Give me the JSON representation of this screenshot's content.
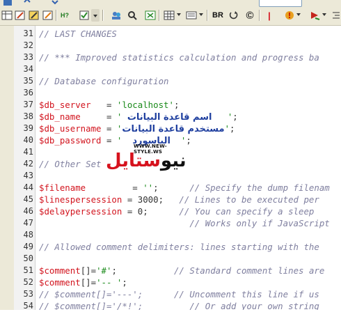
{
  "toolbar": {
    "buttons_row2": [
      {
        "icon": "table-icon"
      },
      {
        "icon": "edit-icon"
      },
      {
        "icon": "pencil-icon"
      },
      {
        "icon": "help-icon"
      },
      {
        "icon": "checklist-icon"
      },
      {
        "icon": "dropdown-arrow-icon"
      },
      {
        "icon": "users-icon"
      },
      {
        "icon": "find-icon"
      },
      {
        "icon": "format-icon"
      },
      {
        "icon": "table-grid-icon"
      },
      {
        "icon": "list-icon"
      },
      {
        "icon": "rotate-icon"
      },
      {
        "icon": "copyright-icon"
      },
      {
        "icon": "exclamation-icon"
      },
      {
        "icon": "arrow-icon"
      }
    ],
    "br_label": "BR",
    "copyright_label": "©"
  },
  "editor": {
    "lines": [
      {
        "no": "31",
        "segments": [
          {
            "t": "cmt",
            "v": "// LAST CHANGES"
          }
        ]
      },
      {
        "no": "32",
        "segments": []
      },
      {
        "no": "33",
        "segments": [
          {
            "t": "cmt",
            "v": "// *** Improved statistics calculation and progress ba"
          }
        ]
      },
      {
        "no": "34",
        "segments": []
      },
      {
        "no": "35",
        "segments": [
          {
            "t": "cmt",
            "v": "// Database configuration"
          }
        ]
      },
      {
        "no": "36",
        "segments": []
      },
      {
        "no": "37",
        "segments": [
          {
            "t": "var",
            "v": "$db_server"
          },
          {
            "t": "op",
            "v": "   = "
          },
          {
            "t": "str",
            "v": "'localhost'"
          },
          {
            "t": "op",
            "v": ";"
          }
        ]
      },
      {
        "no": "38",
        "segments": [
          {
            "t": "var",
            "v": "$db_name"
          },
          {
            "t": "op",
            "v": "     = "
          },
          {
            "t": "str",
            "v": "' "
          },
          {
            "t": "ar",
            "v": "اسم قاعدة البيانات"
          },
          {
            "t": "str",
            "v": "   '"
          },
          {
            "t": "op",
            "v": ";"
          }
        ]
      },
      {
        "no": "39",
        "segments": [
          {
            "t": "var",
            "v": "$db_username"
          },
          {
            "t": "op",
            "v": " = "
          },
          {
            "t": "str",
            "v": "'"
          },
          {
            "t": "ar",
            "v": "مستخدم قاعدة البيانات"
          },
          {
            "t": "str",
            "v": "'"
          },
          {
            "t": "op",
            "v": ";"
          }
        ]
      },
      {
        "no": "40",
        "segments": [
          {
            "t": "var",
            "v": "$db_password"
          },
          {
            "t": "op",
            "v": " = "
          },
          {
            "t": "str",
            "v": "'  "
          },
          {
            "t": "ar",
            "v": "الباسورد"
          },
          {
            "t": "str",
            "v": "  '"
          },
          {
            "t": "op",
            "v": ";"
          }
        ]
      },
      {
        "no": "41",
        "segments": []
      },
      {
        "no": "42",
        "segments": [
          {
            "t": "cmt",
            "v": "// Other Set"
          }
        ]
      },
      {
        "no": "43",
        "segments": []
      },
      {
        "no": "44",
        "segments": [
          {
            "t": "var",
            "v": "$filename"
          },
          {
            "t": "op",
            "v": "         = "
          },
          {
            "t": "str",
            "v": "''"
          },
          {
            "t": "op",
            "v": ";      "
          },
          {
            "t": "cmt",
            "v": "// Specify the dump filenam"
          }
        ]
      },
      {
        "no": "45",
        "segments": [
          {
            "t": "var",
            "v": "$linespersession"
          },
          {
            "t": "op",
            "v": " = 3000;   "
          },
          {
            "t": "cmt",
            "v": "// Lines to be executed per"
          }
        ]
      },
      {
        "no": "46",
        "segments": [
          {
            "t": "var",
            "v": "$delaypersession"
          },
          {
            "t": "op",
            "v": " = 0;      "
          },
          {
            "t": "cmt",
            "v": "// You can specify a sleep"
          }
        ]
      },
      {
        "no": "47",
        "segments": [
          {
            "t": "op",
            "v": "                             "
          },
          {
            "t": "cmt",
            "v": "// Works only if JavaScript"
          }
        ]
      },
      {
        "no": "48",
        "segments": []
      },
      {
        "no": "49",
        "segments": [
          {
            "t": "cmt",
            "v": "// Allowed comment delimiters: lines starting with the"
          }
        ]
      },
      {
        "no": "50",
        "segments": []
      },
      {
        "no": "51",
        "segments": [
          {
            "t": "var",
            "v": "$comment"
          },
          {
            "t": "op",
            "v": "[]="
          },
          {
            "t": "str",
            "v": "'#'"
          },
          {
            "t": "op",
            "v": ";           "
          },
          {
            "t": "cmt",
            "v": "// Standard comment lines are"
          }
        ]
      },
      {
        "no": "52",
        "segments": [
          {
            "t": "var",
            "v": "$comment"
          },
          {
            "t": "op",
            "v": "[]="
          },
          {
            "t": "str",
            "v": "'-- '"
          },
          {
            "t": "op",
            "v": ";"
          }
        ]
      },
      {
        "no": "53",
        "segments": [
          {
            "t": "cmt",
            "v": "// $comment[]='---';      // Uncomment this line if us"
          }
        ]
      },
      {
        "no": "54",
        "segments": [
          {
            "t": "cmt",
            "v": "// $comment[]='/*!';         // Or add your own string"
          }
        ]
      }
    ]
  },
  "watermark": {
    "url": "WWW.NEW-STYLE.WS",
    "logo_black": "نيو",
    "logo_red": "ستايل"
  }
}
